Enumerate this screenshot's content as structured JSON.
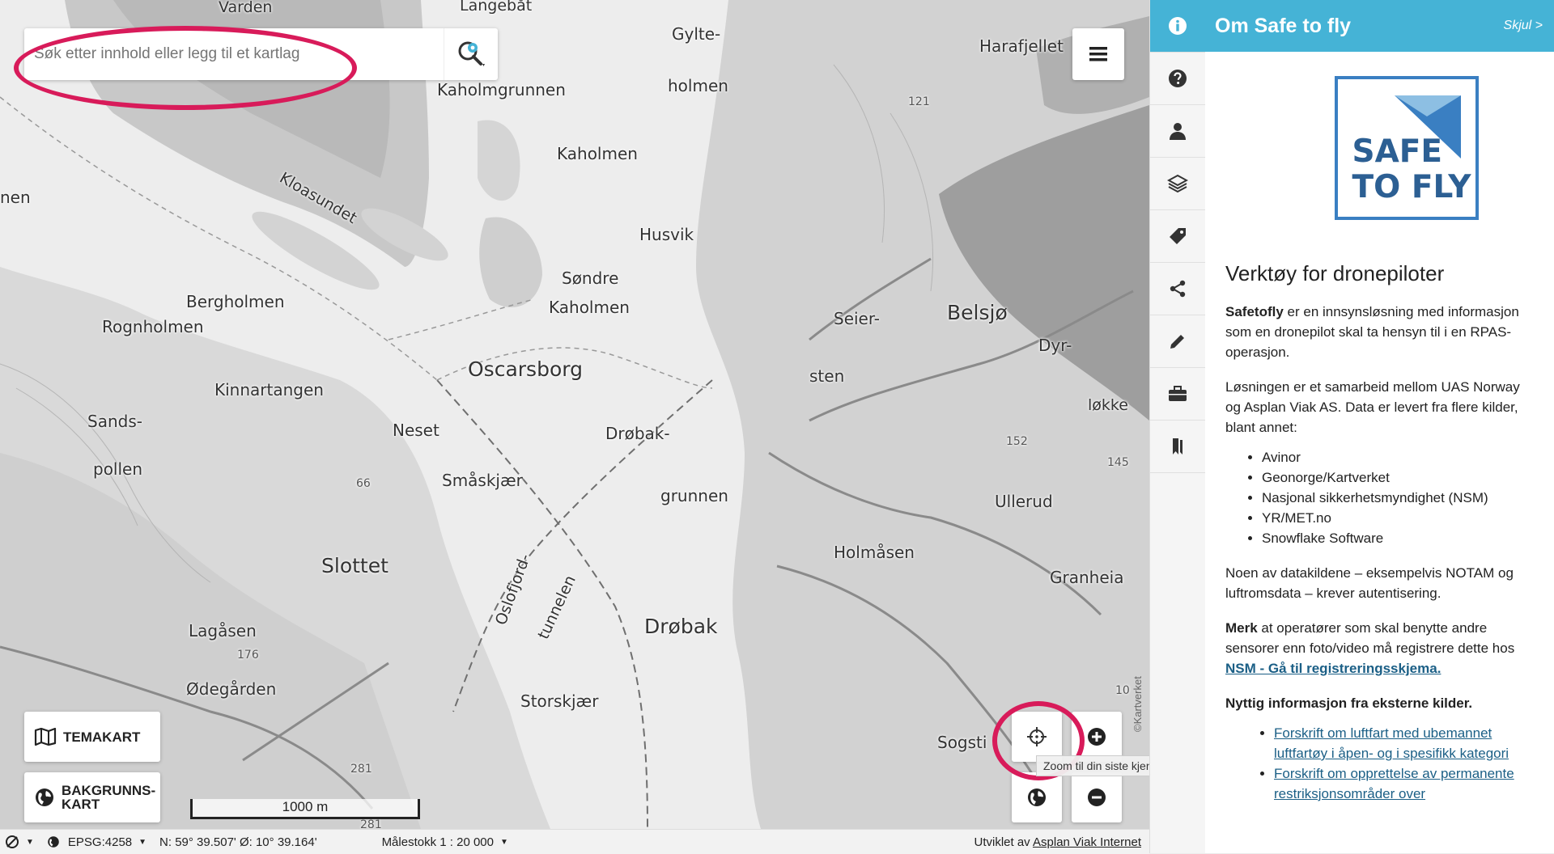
{
  "search": {
    "placeholder": "Søk etter innhold eller legg til et kartlag"
  },
  "places": [
    {
      "name": "Varden"
    },
    {
      "name": "Langebåt"
    },
    {
      "name": "Gylte-"
    },
    {
      "name": "holmen"
    },
    {
      "name": "Harafjellet"
    },
    {
      "name": "Kaholmgrunnen"
    },
    {
      "name": "Kaholmen"
    },
    {
      "name": "Kloasundet"
    },
    {
      "name": "Husvik"
    },
    {
      "name": "Søndre"
    },
    {
      "name": "Kaholmen"
    },
    {
      "name": "Bergholmen"
    },
    {
      "name": "Rognholmen"
    },
    {
      "name": "Oscarsborg"
    },
    {
      "name": "Seier-"
    },
    {
      "name": "sten"
    },
    {
      "name": "Belsjø"
    },
    {
      "name": "Dyr-"
    },
    {
      "name": "løkke"
    },
    {
      "name": "Kinnartangen"
    },
    {
      "name": "Sands-"
    },
    {
      "name": "pollen"
    },
    {
      "name": "Neset"
    },
    {
      "name": "Drøbak-"
    },
    {
      "name": "grunnen"
    },
    {
      "name": "Småskjær"
    },
    {
      "name": "Ullerud"
    },
    {
      "name": "Slottet"
    },
    {
      "name": "Holmåsen"
    },
    {
      "name": "Granheia"
    },
    {
      "name": "Oslofjord-"
    },
    {
      "name": "tunnelen"
    },
    {
      "name": "Drøbak"
    },
    {
      "name": "Lagåsen"
    },
    {
      "name": "Ødegården"
    },
    {
      "name": "Storskjær"
    },
    {
      "name": "Sogsti"
    },
    {
      "name": "nen"
    }
  ],
  "elevations": [
    "121",
    "66",
    "176",
    "281",
    "152",
    "145",
    "281",
    "10"
  ],
  "buttons": {
    "temakart": "TEMAKART",
    "bakgrunn_line1": "BAKGRUNNS-",
    "bakgrunn_line2": "KART"
  },
  "scale_label": "1000 m",
  "tooltip": "Zoom til din siste kjente posisjon",
  "copyright": "©Kartverket",
  "statusbar": {
    "crs": "EPSG:4258",
    "coords": "N: 59° 39.507' Ø: 10° 39.164'",
    "scale": "Målestokk 1 : 20 000",
    "credit_prefix": "Utviklet av",
    "credit_link": "Asplan Viak Internet"
  },
  "panel": {
    "title": "Om Safe to fly",
    "hide": "Skjul >",
    "logo_line1": "SAFE",
    "logo_line2": "TO FLY",
    "heading": "Verktøy for dronepiloter",
    "p1_bold": "Safetofly",
    "p1_rest": " er en innsynsløsning med informasjon som en dronepilot skal ta hensyn til i en RPAS-operasjon.",
    "p2": "Løsningen er et samarbeid mellom UAS Norway og Asplan Viak AS. Data er levert fra flere kilder, blant annet:",
    "sources": [
      "Avinor",
      "Geonorge/Kartverket",
      "Nasjonal sikkerhetsmyndighet (NSM)",
      "YR/MET.no",
      "Snowflake Software"
    ],
    "p3": "Noen av datakildene – eksempelvis NOTAM og luftromsdata – krever autentisering.",
    "p4_bold": "Merk",
    "p4_rest": " at operatører som skal benytte andre sensorer enn foto/video må registrere dette hos ",
    "p4_link": "NSM - Gå til registreringsskjema.",
    "p5": "Nyttig informasjon fra eksterne kilder.",
    "links": [
      "Forskrift om luftfart med ubemannet luftfartøy i åpen- og i spesifikk kategori",
      "Forskrift om opprettelse av permanente restriksjonsområder over"
    ]
  },
  "colors": {
    "accent": "#45b3d6",
    "highlight": "#d81b5a",
    "logo_blue": "#3a7fc2"
  }
}
